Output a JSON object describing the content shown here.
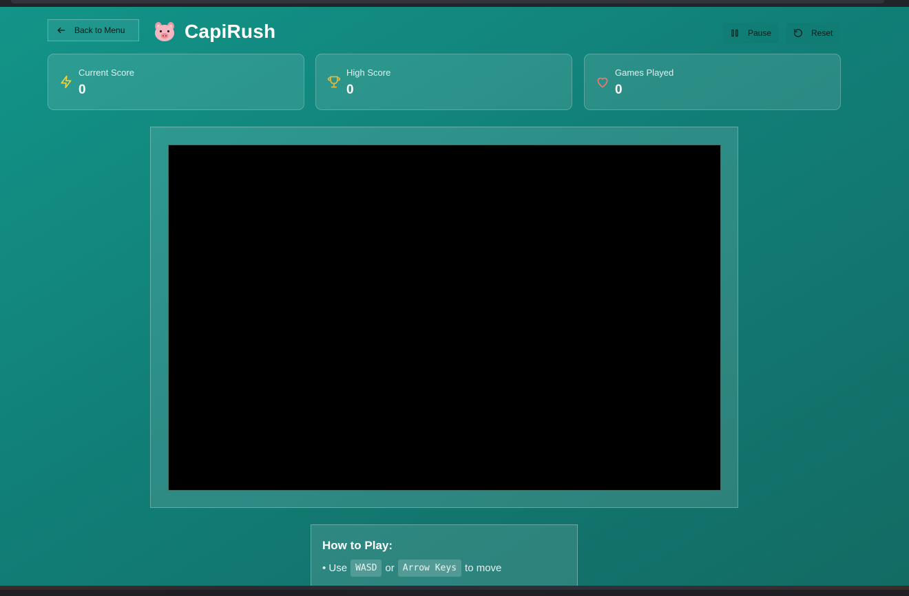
{
  "header": {
    "back_label": "Back to Menu",
    "title": "CapiRush",
    "pause_label": "Pause",
    "reset_label": "Reset"
  },
  "stats": {
    "current_score": {
      "label": "Current Score",
      "value": "0",
      "icon": "zap-icon",
      "color": "#f6d23c"
    },
    "high_score": {
      "label": "High Score",
      "value": "0",
      "icon": "trophy-icon",
      "color": "#e8b83a"
    },
    "games_played": {
      "label": "Games Played",
      "value": "0",
      "icon": "heart-icon",
      "color": "#f0786e"
    }
  },
  "instructions": {
    "title": "How to Play:",
    "line1": {
      "prefix": "• Use",
      "key1": "WASD",
      "middle": "or",
      "key2": "Arrow Keys",
      "suffix": "to move"
    }
  },
  "colors": {
    "background_start": "#139488",
    "background_end": "#136b64",
    "canvas": "#000000",
    "text": "#ffffff"
  }
}
